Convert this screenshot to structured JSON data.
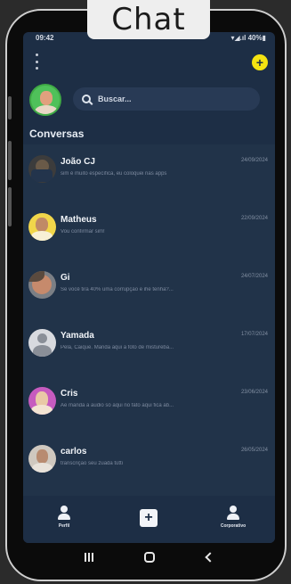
{
  "caption": "Chat",
  "status_bar": {
    "time": "09:42",
    "indicators": "▾◢.ıl 40%▮"
  },
  "header": {
    "menu_icon": "kebab-menu-icon",
    "add_icon": "+"
  },
  "search": {
    "placeholder": "Buscar..."
  },
  "section_title": "Conversas",
  "chats": [
    {
      "name": "João CJ",
      "date": "24/09/2024",
      "preview": "sim é muito específica, eu coloquei nas apps"
    },
    {
      "name": "Matheus",
      "date": "22/09/2024",
      "preview": "Vou confirmar sim!"
    },
    {
      "name": "Gi",
      "date": "24/07/2024",
      "preview": "Se você tira 40% uma corrupção e ihe tenha?..."
    },
    {
      "name": "Yamada",
      "date": "17/07/2024",
      "preview": "Pela, Caique. Manda aqui a foto de mistureba..."
    },
    {
      "name": "Cris",
      "date": "23/06/2024",
      "preview": "Ae manda a audio só aqui no fato aqui fica ab..."
    },
    {
      "name": "carlos",
      "date": "26/05/2024",
      "preview": "transcrição seu zuada tútti"
    }
  ],
  "bottom_nav": {
    "left_label": "Perfil",
    "center_icon": "+",
    "right_label": "Corporativo"
  },
  "colors": {
    "screen_bg": "#1d2e45",
    "list_bg": "#213349",
    "accent": "#f5e311"
  }
}
